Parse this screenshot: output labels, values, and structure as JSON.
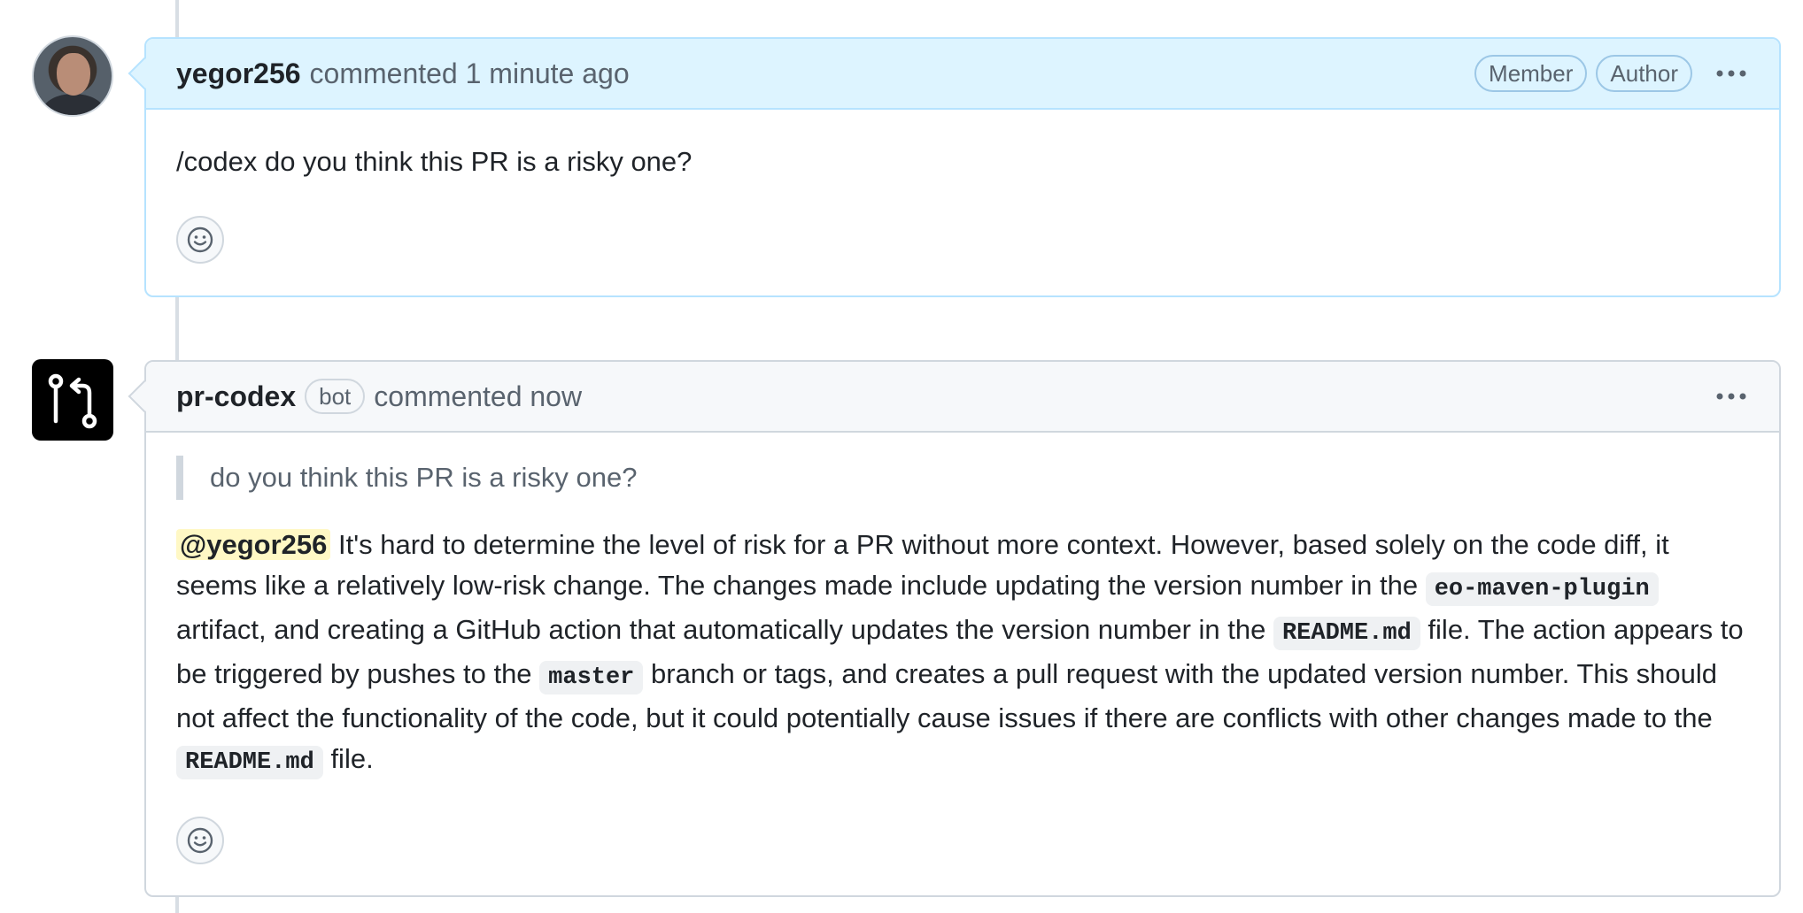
{
  "timeline": {
    "line_color": "#d8dee4"
  },
  "comments": [
    {
      "author": "yegor256",
      "action": "commented",
      "time": "1 minute ago",
      "labels": [
        "Member",
        "Author"
      ],
      "more_icon": "kebab-horizontal-icon",
      "body": "/codex do you think this PR is a risky one?",
      "reaction_icon": "smiley-icon",
      "header_bg": "#ddf4ff"
    },
    {
      "author": "pr-codex",
      "badge": "bot",
      "action": "commented",
      "time": "now",
      "more_icon": "kebab-horizontal-icon",
      "quote": "do you think this PR is a risky one?",
      "mention": "@yegor256",
      "body": {
        "p1": " It's hard to determine the level of risk for a PR without more context. However, based solely on the code diff, it seems like a relatively low-risk change. The changes made include updating the version number in the ",
        "c1": "eo-maven-plugin",
        "p2": " artifact, and creating a GitHub action that automatically updates the version number in the ",
        "c2": "README.md",
        "p3": " file. The action appears to be triggered by pushes to the ",
        "c3": "master",
        "p4": " branch or tags, and creates a pull request with the updated version number. This should not affect the functionality of the code, but it could potentially cause issues if there are conflicts with other changes made to the ",
        "c4": "README.md",
        "p5": " file."
      },
      "reaction_icon": "smiley-icon",
      "header_bg": "#f6f8fa"
    }
  ]
}
